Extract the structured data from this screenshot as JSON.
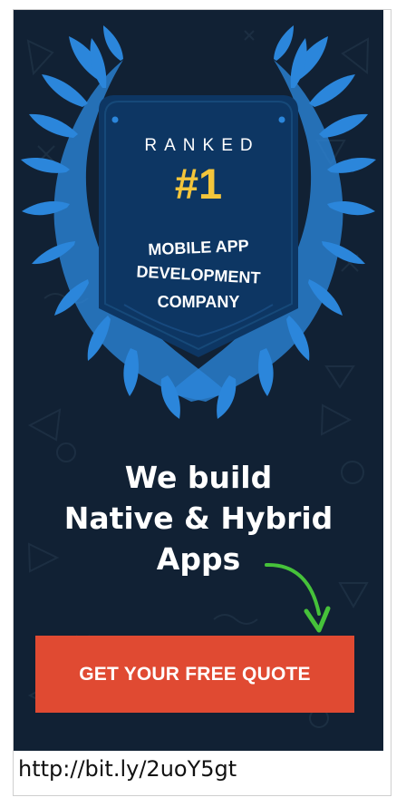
{
  "ad": {
    "badge": {
      "ranked": "RANKED",
      "rank": "#1",
      "company_lines": [
        "MOBILE APP",
        "DEVELOPMENT",
        "COMPANY"
      ]
    },
    "headline_lines": [
      "We build",
      "Native & Hybrid",
      "Apps"
    ],
    "cta_label": "GET YOUR FREE QUOTE",
    "url": "http://bit.ly/2uoY5gt"
  },
  "icons": {
    "laurel": "laurel-wreath-icon",
    "shield": "shield-badge-icon",
    "arrow": "curved-arrow-down-icon",
    "pattern": "background-shape-pattern"
  },
  "colors": {
    "background": "#112134",
    "badge": "#0d3663",
    "laurel": "#2b86db",
    "laurel_shadow": "#1d5fa6",
    "rank_number": "#f3c53b",
    "cta": "#e04a32",
    "arrow": "#46c23a",
    "text": "#ffffff"
  }
}
